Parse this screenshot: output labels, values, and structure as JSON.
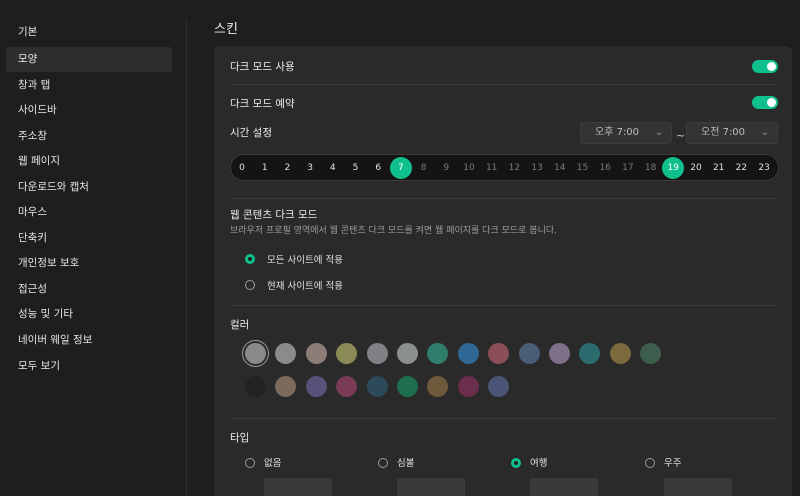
{
  "sidebar": {
    "items": [
      {
        "label": "기본"
      },
      {
        "label": "모양"
      },
      {
        "label": "창과 탭"
      },
      {
        "label": "사이드바"
      },
      {
        "label": "주소창"
      },
      {
        "label": "웹 페이지"
      },
      {
        "label": "다운로드와 캡처"
      },
      {
        "label": "마우스"
      },
      {
        "label": "단축키"
      },
      {
        "label": "개인정보 보호"
      },
      {
        "label": "접근성"
      },
      {
        "label": "성능 및 기타"
      },
      {
        "label": "네이버 웨일 정보"
      },
      {
        "label": "모두 보기"
      }
    ],
    "active_index": 1
  },
  "main": {
    "title": "스킨",
    "dark_mode": {
      "label": "다크 모드 사용",
      "enabled": true
    },
    "dark_schedule": {
      "label": "다크 모드 예약",
      "enabled": true
    },
    "time_setting": {
      "label": "시간 설정",
      "from": "오후 7:00",
      "separator": "~",
      "to": "오전 7:00",
      "hours": [
        "0",
        "1",
        "2",
        "3",
        "4",
        "5",
        "6",
        "7",
        "8",
        "9",
        "10",
        "11",
        "12",
        "13",
        "14",
        "15",
        "16",
        "17",
        "18",
        "19",
        "20",
        "21",
        "22",
        "23"
      ],
      "selected": [
        7,
        19
      ]
    },
    "web_dark": {
      "title": "웹 콘텐츠 다크 모드",
      "description": "브라우저 프로필 영역에서 웹 콘텐츠 다크 모드를 켜면 웹 페이지를 다크 모드로 봅니다.",
      "options": [
        {
          "label": "모든 사이트에 적용",
          "checked": true
        },
        {
          "label": "현재 사이트에 적용",
          "checked": false
        }
      ]
    },
    "color": {
      "label": "컬러",
      "swatches_row1": [
        "#8a8a8a",
        "#8b8b8b",
        "#8c7d76",
        "#8a8a56",
        "#7f8186",
        "#8c908d",
        "#2f7e6c",
        "#2f6795",
        "#8a4f58",
        "#4a5d76",
        "#7f6f8a",
        "#2b6b6e",
        "#7a6a3c",
        "#3d5e4d"
      ],
      "swatches_row2": [
        "#232323",
        "#7c6a5c",
        "#58527a",
        "#793b55",
        "#2c4a5a",
        "#1f6e4e",
        "#6e5a3a",
        "#6b2f4d",
        "#4a5577"
      ],
      "selected_index": 0
    },
    "type": {
      "label": "타입",
      "options": [
        {
          "label": "없음",
          "checked": false
        },
        {
          "label": "심볼",
          "checked": false
        },
        {
          "label": "여행",
          "checked": true
        },
        {
          "label": "우주",
          "checked": false
        }
      ]
    }
  }
}
